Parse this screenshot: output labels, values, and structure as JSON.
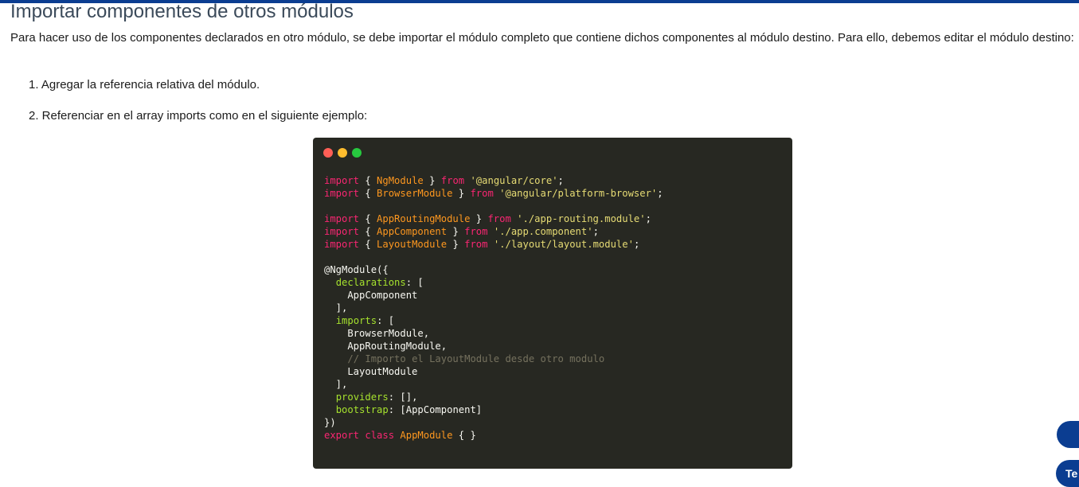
{
  "section": {
    "title": "Importar componentes de otros módulos",
    "intro": "Para hacer uso de los componentes declarados en otro módulo, se debe importar el módulo completo que contiene dichos componentes al módulo destino. Para ello, debemos editar el módulo destino:",
    "steps": [
      "1. Agregar la referencia relativa del módulo.",
      "2. Referenciar en el array imports como en el siguiente ejemplo:"
    ]
  },
  "code_block": {
    "window_dots": [
      "red",
      "yellow",
      "green"
    ],
    "colors": {
      "background": "#272822",
      "keyword": "#f92672",
      "identifier": "#fd971f",
      "string": "#e6db74",
      "property": "#a6e22e",
      "comment": "#75715e"
    },
    "lines": [
      [
        {
          "t": "kw",
          "v": "import"
        },
        {
          "t": "",
          "v": " { "
        },
        {
          "t": "fn",
          "v": "NgModule"
        },
        {
          "t": "",
          "v": " } "
        },
        {
          "t": "kw",
          "v": "from"
        },
        {
          "t": "",
          "v": " "
        },
        {
          "t": "str",
          "v": "'@angular/core'"
        },
        {
          "t": "",
          "v": ";"
        }
      ],
      [
        {
          "t": "kw",
          "v": "import"
        },
        {
          "t": "",
          "v": " { "
        },
        {
          "t": "fn",
          "v": "BrowserModule"
        },
        {
          "t": "",
          "v": " } "
        },
        {
          "t": "kw",
          "v": "from"
        },
        {
          "t": "",
          "v": " "
        },
        {
          "t": "str",
          "v": "'@angular/platform-browser'"
        },
        {
          "t": "",
          "v": ";"
        }
      ],
      [],
      [
        {
          "t": "kw",
          "v": "import"
        },
        {
          "t": "",
          "v": " { "
        },
        {
          "t": "fn",
          "v": "AppRoutingModule"
        },
        {
          "t": "",
          "v": " } "
        },
        {
          "t": "kw",
          "v": "from"
        },
        {
          "t": "",
          "v": " "
        },
        {
          "t": "str",
          "v": "'./app-routing.module'"
        },
        {
          "t": "",
          "v": ";"
        }
      ],
      [
        {
          "t": "kw",
          "v": "import"
        },
        {
          "t": "",
          "v": " { "
        },
        {
          "t": "fn",
          "v": "AppComponent"
        },
        {
          "t": "",
          "v": " } "
        },
        {
          "t": "kw",
          "v": "from"
        },
        {
          "t": "",
          "v": " "
        },
        {
          "t": "str",
          "v": "'./app.component'"
        },
        {
          "t": "",
          "v": ";"
        }
      ],
      [
        {
          "t": "kw",
          "v": "import"
        },
        {
          "t": "",
          "v": " { "
        },
        {
          "t": "fn",
          "v": "LayoutModule"
        },
        {
          "t": "",
          "v": " } "
        },
        {
          "t": "kw",
          "v": "from"
        },
        {
          "t": "",
          "v": " "
        },
        {
          "t": "str",
          "v": "'./layout/layout.module'"
        },
        {
          "t": "",
          "v": ";"
        }
      ],
      [],
      [
        {
          "t": "",
          "v": "@NgModule({"
        }
      ],
      [
        {
          "t": "",
          "v": "  "
        },
        {
          "t": "prop",
          "v": "declarations"
        },
        {
          "t": "",
          "v": ": ["
        }
      ],
      [
        {
          "t": "",
          "v": "    AppComponent"
        }
      ],
      [
        {
          "t": "",
          "v": "  ],"
        }
      ],
      [
        {
          "t": "",
          "v": "  "
        },
        {
          "t": "prop",
          "v": "imports"
        },
        {
          "t": "",
          "v": ": ["
        }
      ],
      [
        {
          "t": "",
          "v": "    BrowserModule,"
        }
      ],
      [
        {
          "t": "",
          "v": "    AppRoutingModule,"
        }
      ],
      [
        {
          "t": "",
          "v": "    "
        },
        {
          "t": "cm",
          "v": "// Importo el LayoutModule desde otro modulo"
        }
      ],
      [
        {
          "t": "",
          "v": "    LayoutModule"
        }
      ],
      [
        {
          "t": "",
          "v": "  ],"
        }
      ],
      [
        {
          "t": "",
          "v": "  "
        },
        {
          "t": "prop",
          "v": "providers"
        },
        {
          "t": "",
          "v": ": [],"
        }
      ],
      [
        {
          "t": "",
          "v": "  "
        },
        {
          "t": "prop",
          "v": "bootstrap"
        },
        {
          "t": "",
          "v": ": [AppComponent]"
        }
      ],
      [
        {
          "t": "",
          "v": "})"
        }
      ],
      [
        {
          "t": "kw",
          "v": "export"
        },
        {
          "t": "",
          "v": " "
        },
        {
          "t": "kw",
          "v": "class"
        },
        {
          "t": "",
          "v": " "
        },
        {
          "t": "fn",
          "v": "AppModule"
        },
        {
          "t": "",
          "v": " { }"
        }
      ]
    ]
  },
  "floating_buttons": [
    {
      "label": ""
    },
    {
      "label": "Te"
    }
  ]
}
